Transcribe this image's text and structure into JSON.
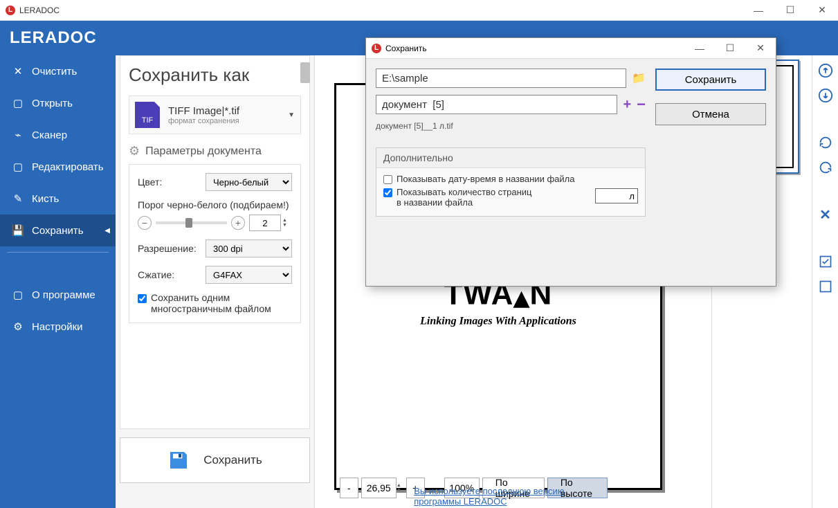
{
  "titlebar": {
    "app_name": "LERADOC"
  },
  "ribbon": {
    "logo": "LERADOC"
  },
  "sidebar": {
    "items": [
      {
        "label": "Очистить"
      },
      {
        "label": "Открыть"
      },
      {
        "label": "Сканер"
      },
      {
        "label": "Редактировать"
      },
      {
        "label": "Кисть"
      },
      {
        "label": "Сохранить"
      }
    ],
    "about": "О программе",
    "settings": "Настройки"
  },
  "panel": {
    "title": "Сохранить как",
    "format_name": "TIFF Image|*.tif",
    "format_sub": "формат сохранения",
    "format_badge": "TIF",
    "params_title": "Параметры документа",
    "color_label": "Цвет:",
    "color_value": "Черно-белый",
    "threshold_label": "Порог черно-белого (подбираем!)",
    "threshold_value": "2",
    "resolution_label": "Разрешение:",
    "resolution_value": "300 dpi",
    "compression_label": "Сжатие:",
    "compression_value": "G4FAX",
    "multipage_label": "Сохранить одним многостраничным файлом",
    "save_button": "Сохранить"
  },
  "preview": {
    "twain": "TWAIN",
    "tagline": "Linking Images With Applications"
  },
  "zoombar": {
    "value": "26,95",
    "zoom_pct": "100%",
    "fit_width": "По ширине",
    "fit_height": "По высоте"
  },
  "bottom_link": "Вы используете последнюю версию программы LERADOC",
  "dialog": {
    "title": "Сохранить",
    "path": "E:\\sample",
    "filename": "документ  [5]",
    "preview_name": "документ [5]__1 л.tif",
    "group_title": "Дополнительно",
    "chk_datetime": "Показывать дату-время в названии файла",
    "chk_pages": "Показывать количество страниц в названии файла",
    "suffix_field": "л",
    "save_btn": "Сохранить",
    "cancel_btn": "Отмена"
  }
}
